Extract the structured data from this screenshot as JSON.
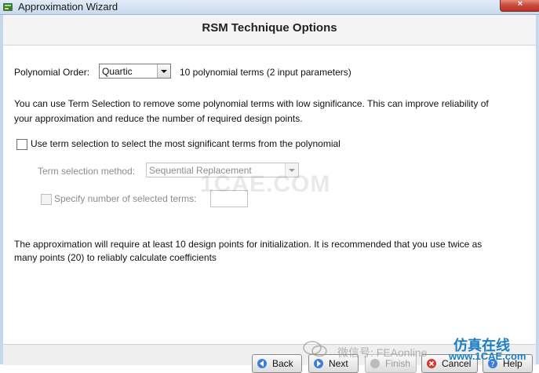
{
  "window": {
    "title": "Approximation Wizard",
    "close_glyph": "×"
  },
  "page": {
    "heading": "RSM Technique Options"
  },
  "polynomial": {
    "label": "Polynomial Order:",
    "selected": "Quartic",
    "terms_text": "10 polynomial terms (2 input parameters)"
  },
  "info": {
    "line1": "You can use Term Selection to remove some polynomial terms with low significance. This can improve reliability of",
    "line2": "your approximation and reduce the number of required design points."
  },
  "term_selection": {
    "checkbox_label": "Use term selection to select the most significant terms from the polynomial",
    "checked": false,
    "method_label": "Term selection method:",
    "method_selected": "Sequential Replacement",
    "specify_label": "Specify number of selected terms:",
    "specify_checked": false,
    "specify_value": ""
  },
  "requirement": {
    "line1": "The approximation will require at least 10 design points for initialization. It is recommended that you use twice as",
    "line2": "many points (20) to reliably calculate coefficients"
  },
  "buttons": {
    "back": "Back",
    "next": "Next",
    "finish": "Finish",
    "cancel": "Cancel",
    "help": "Help"
  },
  "watermarks": {
    "center": "1CAE.COM",
    "wechat": "微信号: FEAonline",
    "cn": "仿真在线",
    "url": "www.1CAE.com"
  },
  "colors": {
    "title_bar": "#c9d9ee",
    "close_button": "#c8483a",
    "watermark_blue": "#1c7fc4"
  }
}
